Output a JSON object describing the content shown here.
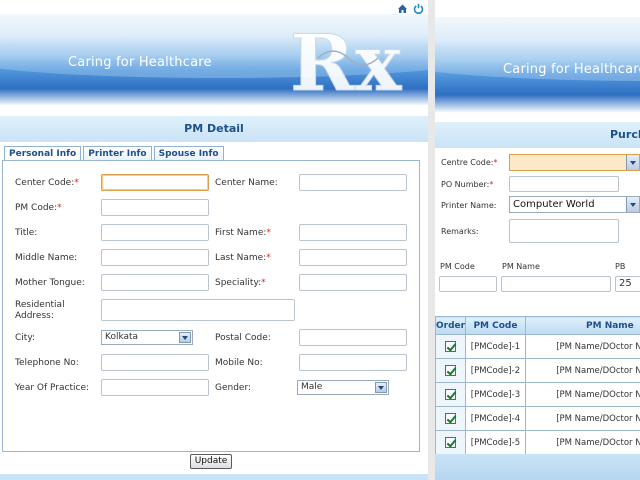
{
  "banner": {
    "tagline": "Caring for Healthcare",
    "logo_text": "Rx"
  },
  "left": {
    "title": "PM Detail",
    "tabs": [
      {
        "label": "Personal Info",
        "active": true
      },
      {
        "label": "Printer Info",
        "active": false
      },
      {
        "label": "Spouse Info",
        "active": false
      }
    ],
    "fields": {
      "center_code": {
        "label": "Center Code:",
        "required": "*",
        "value": ""
      },
      "center_name": {
        "label": "Center Name:",
        "value": ""
      },
      "pm_code": {
        "label": "PM Code:",
        "required": "*",
        "value": ""
      },
      "title": {
        "label": "Title:",
        "value": ""
      },
      "first_name": {
        "label": "First Name:",
        "required": "*",
        "value": ""
      },
      "middle_name": {
        "label": "Middle Name:",
        "value": ""
      },
      "last_name": {
        "label": "Last Name:",
        "required": "*",
        "value": ""
      },
      "mother_tongue": {
        "label": "Mother Tongue:",
        "value": ""
      },
      "speciality": {
        "label": "Speciality:",
        "required": "*",
        "value": ""
      },
      "residential_address": {
        "label_line1": "Residential",
        "label_line2": "Address:",
        "value": ""
      },
      "city": {
        "label": "City:",
        "value": "Kolkata"
      },
      "postal_code": {
        "label": "Postal Code:",
        "value": ""
      },
      "telephone": {
        "label": "Telephone No:",
        "value": ""
      },
      "mobile": {
        "label": "Mobile No:",
        "value": ""
      },
      "year_of_practice": {
        "label": "Year Of Practice:",
        "value": ""
      },
      "gender": {
        "label": "Gender:",
        "value": "Male"
      }
    },
    "update_button": "Update"
  },
  "right": {
    "title": "Purch",
    "centre_code": {
      "label": "Centre Code:",
      "required": "*",
      "value": ""
    },
    "po_number": {
      "label": "PO Number:",
      "required": "*",
      "value": ""
    },
    "printer_name": {
      "label": "Printer Name:",
      "value": "Computer World"
    },
    "remarks": {
      "label": "Remarks:",
      "value": ""
    },
    "filter_labels": {
      "pm_code": "PM Code",
      "pm_name": "PM Name",
      "pb": "PB"
    },
    "filter_values": {
      "pm_code": "",
      "pm_name": "",
      "pb": "25"
    },
    "table": {
      "headers": [
        "Order",
        "PM Code",
        "PM Name"
      ],
      "rows": [
        {
          "checked": true,
          "code": "[PMCode]-1",
          "name": "[PM Name/DOctor Name]"
        },
        {
          "checked": true,
          "code": "[PMCode]-2",
          "name": "[PM Name/DOctor Name]"
        },
        {
          "checked": true,
          "code": "[PMCode]-3",
          "name": "[PM Name/DOctor Name]"
        },
        {
          "checked": true,
          "code": "[PMCode]-4",
          "name": "[PM Name/DOctor Name]"
        },
        {
          "checked": true,
          "code": "[PMCode]-5",
          "name": "[PM Name/DOctor Name]"
        }
      ]
    }
  },
  "icons": [
    "home-icon",
    "power-icon"
  ]
}
